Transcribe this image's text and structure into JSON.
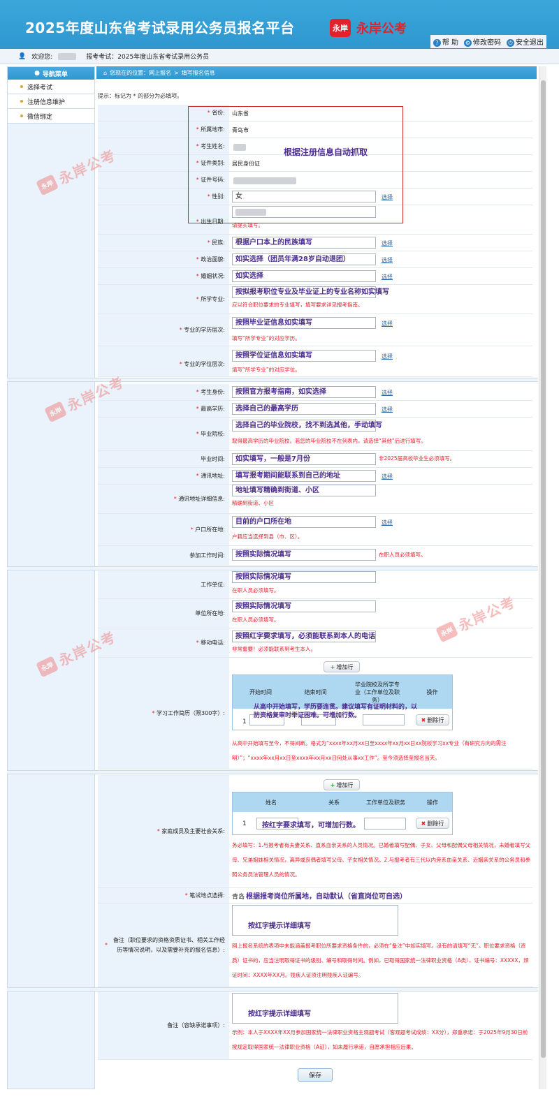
{
  "app": {
    "title": "2025年度山东省考试录用公务员报名平台",
    "brand_badge": "永岸",
    "brand_name": "永岸公考",
    "links": {
      "help": "帮 助",
      "change_password": "修改密码",
      "logout": "安全退出"
    }
  },
  "welcome": {
    "greeting": "欢迎您:",
    "exam": "报考考试：2025年度山东省考试录用公务员"
  },
  "sidebar": {
    "title": "导航菜单",
    "items": [
      "选择考试",
      "注册信息维护",
      "微信绑定"
    ]
  },
  "breadcrumb": {
    "location": "您现在的位置：网上报名",
    "sep": ">",
    "current": "填写报名信息"
  },
  "hint": "提示：标记为 * 的部分为必填项。",
  "auto_note": "根据注册信息自动抓取",
  "select_link": "选择",
  "fields": {
    "province": {
      "label": "省份:",
      "value": "山东省"
    },
    "city": {
      "label": "所属地市:",
      "value": "青岛市"
    },
    "name": {
      "label": "考生姓名:"
    },
    "id_type": {
      "label": "证件类别:",
      "value": "居民身份证"
    },
    "id_no": {
      "label": "证件号码:"
    },
    "gender": {
      "label": "性别:",
      "value": "女"
    },
    "birth": {
      "label": "出生日期:",
      "note": "请提实填写。"
    },
    "ethnic": {
      "label": "民族:",
      "value": "根据户口本上的民族填写"
    },
    "political": {
      "label": "政治面貌:",
      "value": "如实选择（团员年满28岁自动退团）"
    },
    "marriage": {
      "label": "婚姻状况:",
      "value": "如实选择"
    },
    "major": {
      "label": "所学专业:",
      "value": "按拟报考职位专业及毕业证上的专业名称如实填写",
      "note": "应以符合职位要求的专业填写，填写要求详见报考指南。"
    },
    "major_level": {
      "label": "专业的学历层次:",
      "value": "按照毕业证信息如实填写",
      "note": "填写“所学专业”的对应学历。"
    },
    "degree_level": {
      "label": "专业的学位层次:",
      "value": "按照学位证信息如实填写",
      "note": "填写“所学专业”的对应学位。"
    },
    "identity": {
      "label": "考生身份:",
      "value": "按照官方报考指南，如实选择"
    },
    "education": {
      "label": "最高学历:",
      "value": "选择自己的最高学历"
    },
    "school": {
      "label": "毕业院校:",
      "value": "选择自己的毕业院校，找不到选其他，手动填写",
      "note": "取得最高学历的毕业院校。若您的毕业院校不在列表内，请选择“其他”后进行填写。"
    },
    "grad_time": {
      "label": "毕业时间:",
      "value": "如实填写，一般是7月份",
      "note": "非2025届高校毕业生必须填写。"
    },
    "address": {
      "label": "通讯地址:",
      "value": "填写报考期间能联系到自己的地址"
    },
    "address_detail": {
      "label": "通讯地址详细信息:",
      "value": "地址填写精确到街道、小区",
      "note": "精确到街道、小区"
    },
    "hukou": {
      "label": "户口所在地:",
      "value": "目前的户口所在地",
      "note": "户籍应当选择到县（市、区）。"
    },
    "work_time": {
      "label": "参加工作时间:",
      "value": "按照实际情况填写",
      "note": "在职人员必须填写。"
    },
    "employer": {
      "label": "工作单位:",
      "value": "按照实际情况填写",
      "note": "在职人员必须填写。"
    },
    "employer_loc": {
      "label": "单位所在地:",
      "value": "按照实际情况填写",
      "note": "在职人员必须填写。"
    },
    "phone": {
      "label": "移动电话:",
      "value": "按照红字要求填写，必须能联系到本人的电话",
      "note": "非常重要！必须能联系到考生本人。"
    },
    "resume": {
      "label": "学习工作简历（限300字）:",
      "add": "增加行",
      "cols": [
        "开始时间",
        "结束时间",
        "毕业院校及所学专业（工作单位及职务）",
        "操作"
      ],
      "row_no": "1",
      "delete": "删除行",
      "overlay": "从高中开始填写，学历要连贯。建议填写有证明材料的，以防资格复审时举证困难。可增加行数。",
      "note": "从高中开始填写至今，不得间断。格式为“xxxx年xx月xx日至xxxx年xx月xx日xx院校学习xx专业（有研究方向的需注明）”；“xxxx年xx月xx日至xxxx年xx月xx日何处从事xx工作”。至今须选择至报名当天。"
    },
    "family": {
      "label": "家庭成员及主要社会关系:",
      "add": "增加行",
      "cols": [
        "姓名",
        "关系",
        "工作单位及职务",
        "操作"
      ],
      "row_no": "1",
      "delete": "删除行",
      "overlay": "按红字要求填写，可增加行数。",
      "note": "务必填写：1.与报考者有夫妻关系、直系血亲关系的人员情况。已婚者填写配偶、子女、父母和配偶父母相关情况，未婚者填写父母、兄弟姐妹相关情况，离异或丧偶者填写父母、子女相关情况。2.与报考者有三代以内旁系血亲关系、近姻亲关系的公务员和参照公务员法管理人员的情况。"
    },
    "exam_site": {
      "label": "笔试地点选择:",
      "value": "青岛",
      "note": "根据报考岗位所属地，自动默认（省直岗位可自选）"
    },
    "remark": {
      "label": "备注（职位要求的资格资质证书、相关工作经历等情况说明，以及需要补充的报名信息）:",
      "value": "按红字提示详细填写",
      "note": "网上报名系统的表项中未能涵盖报考职位所要求资格条件的，必须在“备注”中如实填写。没有的请填写“无”。职位要求资格（资质）证书的，应当注明取得证书的级别、编号和取得时间。例如，已取得国家统一法律职业资格（A类），证书编号：XXXXX，颁证时间：XXXX年XX月。残疾人证须注明残疾人证编号。"
    },
    "commit": {
      "label": "备注（容缺承诺事项）:",
      "value": "按红字提示详细填写",
      "note": "示例：本人于XXXX年XX月参加国家统一法律职业资格主观题考试（客观题考试成绩：XX分），郑重承诺：于2025年9月30日前按规定取得国家统一法律职业资格（A证），如未履行承诺，自愿承担相应后果。"
    }
  },
  "save": "保存",
  "colors": {
    "header": "#2f97cf",
    "accent_red": "#e3212b",
    "overlay_purple": "#4b2c8f",
    "label_bg": "#eaf3fb"
  }
}
